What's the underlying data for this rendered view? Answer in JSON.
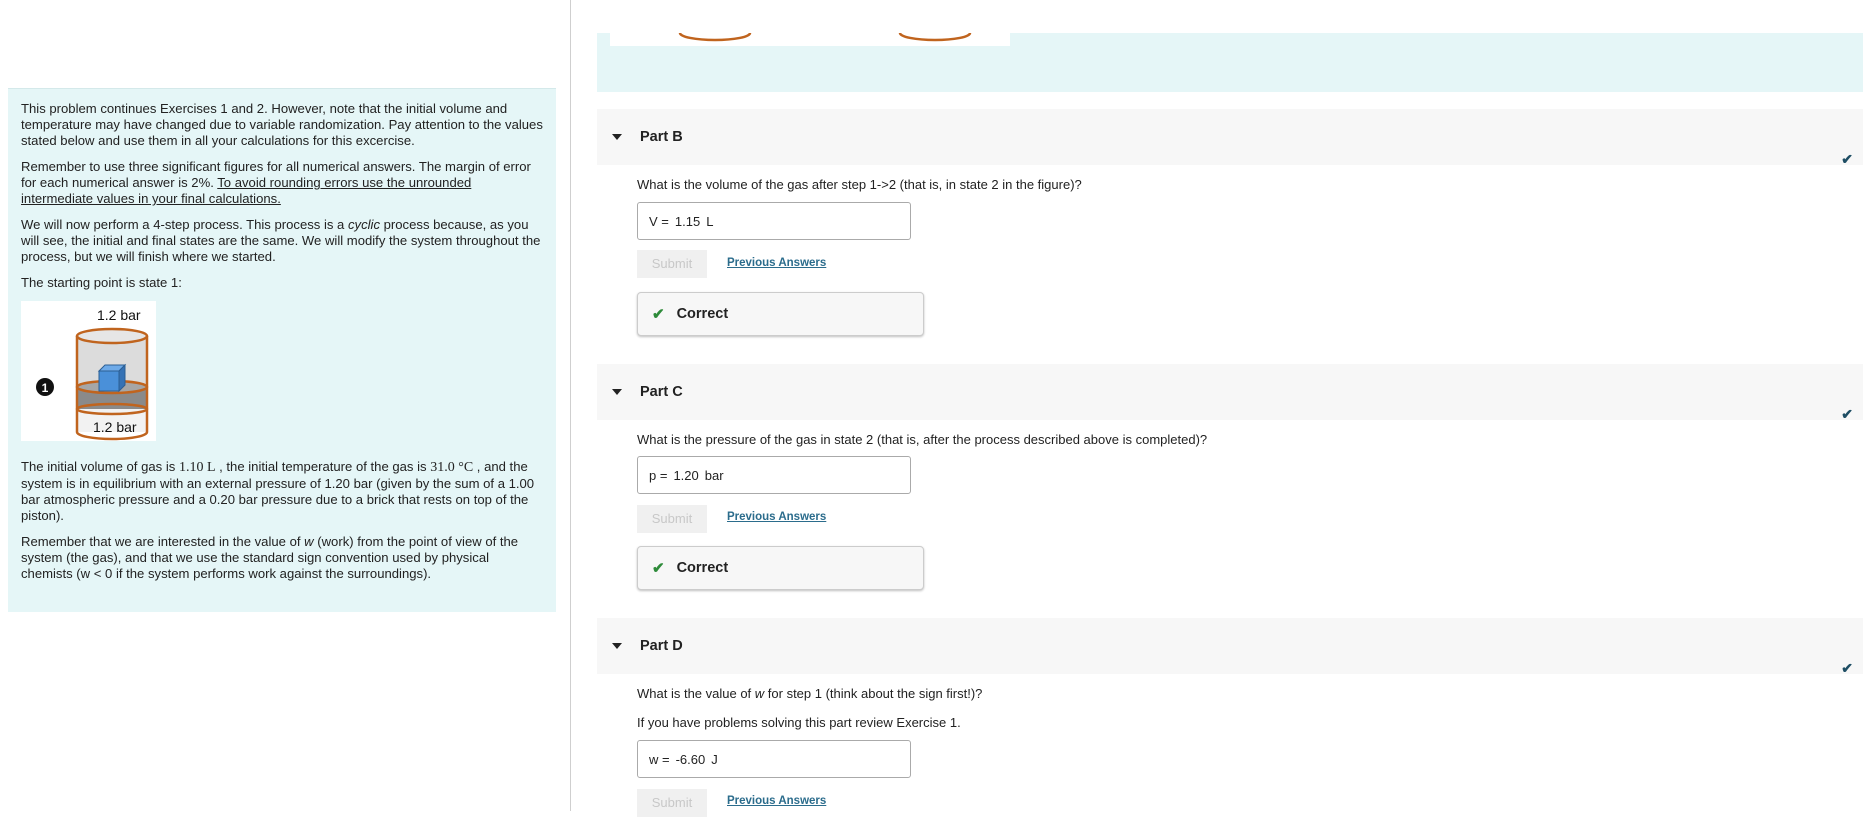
{
  "intro": {
    "p1": "This problem continues Exercises 1 and 2. However, note that the initial volume and temperature may have changed due to variable randomization. Pay attention to the values stated below and use them in all your calculations for this excercise.",
    "p2_a": "Remember to use three significant figures for all numerical answers. The margin of error for each numerical answer is 2%. ",
    "p2_b": "To avoid rounding errors use the unrounded intermediate values in your final calculations.",
    "p3_a": "We will now perform a 4-step process. This process is a ",
    "p3_em": "cyclic",
    "p3_b": " process because, as you will see, the initial and final states are the same. We will modify the system throughout the process, but we will finish where we started.",
    "p4": "The starting point is state 1:",
    "figure": {
      "state_marker": "1",
      "top_label": "1.2 bar",
      "bottom_label": "1.2 bar"
    },
    "p5_a": "The initial volume of gas is ",
    "p5_vol": "1.10 L",
    "p5_b": " , the initial temperature of the gas is ",
    "p5_temp": "31.0 °C",
    "p5_c": " , and the system is in equilibrium with an external pressure of 1.20 bar (given by the sum of a 1.00 bar atmospheric pressure and a 0.20 bar pressure due to a brick that rests on top of the piston).",
    "p6_a": "Remember that we are interested in the value of ",
    "p6_em": "w",
    "p6_b": " (work) from the point of view of the system (the gas), and that we use the standard sign convention used by physical chemists (w < 0 if the system performs work against the surroundings)."
  },
  "parts": [
    {
      "title": "Part B",
      "question": "What is the volume of the gas after step 1->2 (that is, in state 2 in the figure)?",
      "var": "V =",
      "value": "1.15",
      "unit": "L",
      "submit": "Submit",
      "prev": "Previous Answers",
      "feedback": "Correct"
    },
    {
      "title": "Part C",
      "question": "What is the pressure of the gas in state 2 (that is, after the process described above is completed)?",
      "var": "p =",
      "value": "1.20",
      "unit": "bar",
      "submit": "Submit",
      "prev": "Previous Answers",
      "feedback": "Correct"
    },
    {
      "title": "Part D",
      "question_a": "What is the value of ",
      "question_em": "w",
      "question_b": " for step 1 (think about the sign first!)?",
      "hint": "If you have problems solving this part review Exercise 1.",
      "var": "w =",
      "value": "-6.60",
      "unit": "J",
      "submit": "Submit",
      "prev": "Previous Answers"
    }
  ],
  "colors": {
    "panel_bg": "#e5f6f7",
    "link": "#2b6c8c",
    "correct": "#2e8b3a",
    "done_check": "#1e4e64"
  }
}
